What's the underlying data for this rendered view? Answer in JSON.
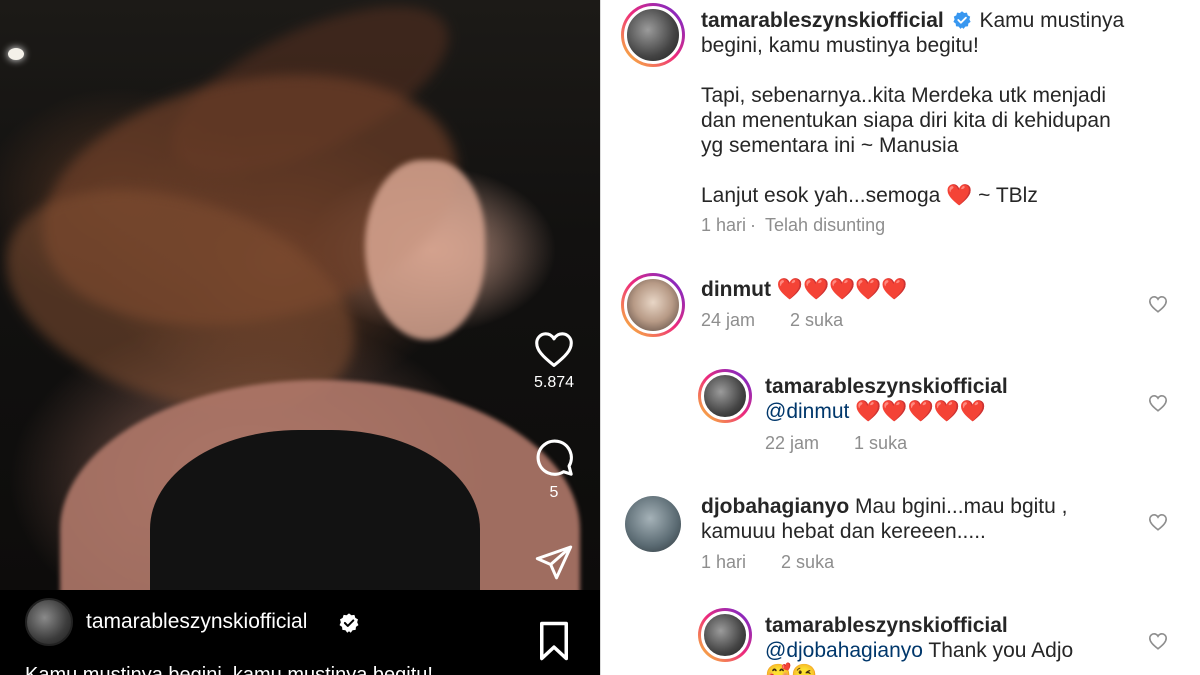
{
  "video": {
    "likes_count": "5.874",
    "comments_count": "5",
    "author_name": "tamarableszynskiofficial",
    "caption_preview": "Kamu mustinya begini, kamu mustinya begitu! ..."
  },
  "post": {
    "username": "tamarableszynskiofficial",
    "caption_lines": [
      "Kamu mustinya",
      "begini, kamu mustinya begitu!",
      "",
      "Tapi, sebenarnya..kita Merdeka utk menjadi",
      "dan menentukan siapa diri kita di kehidupan",
      "yg sementara ini ~ Manusia",
      "",
      "Lanjut esok yah...semoga ❤️ ~ TBlz"
    ],
    "time": "1 hari",
    "edited": "Telah disunting"
  },
  "comments": [
    {
      "username": "dinmut",
      "text": "❤️❤️❤️❤️❤️",
      "time": "24 jam",
      "likes": "2 suka"
    },
    {
      "username": "tamarableszynskiofficial",
      "mention": "@dinmut",
      "text": "❤️❤️❤️❤️❤️",
      "time": "22 jam",
      "likes": "1 suka"
    },
    {
      "username": "djobahagianyo",
      "text_line1": "Mau bgini...mau bgitu ,",
      "text_line2": "kamuuu hebat dan kereeen.....",
      "time": "1 hari",
      "likes": "2 suka"
    },
    {
      "username": "tamarableszynskiofficial",
      "mention": "@djobahagianyo",
      "text": "Thank you Adjo",
      "emoji_line": "🥰😘"
    }
  ],
  "colors": {
    "verified": "#3897f0",
    "mention": "#00376b",
    "meta_text": "#8e8e8e",
    "heart_emoji": "#e0182b"
  },
  "icons": [
    "heart-icon",
    "comment-icon",
    "share-icon",
    "bookmark-icon",
    "verified-badge-icon",
    "like-heart-icon"
  ]
}
